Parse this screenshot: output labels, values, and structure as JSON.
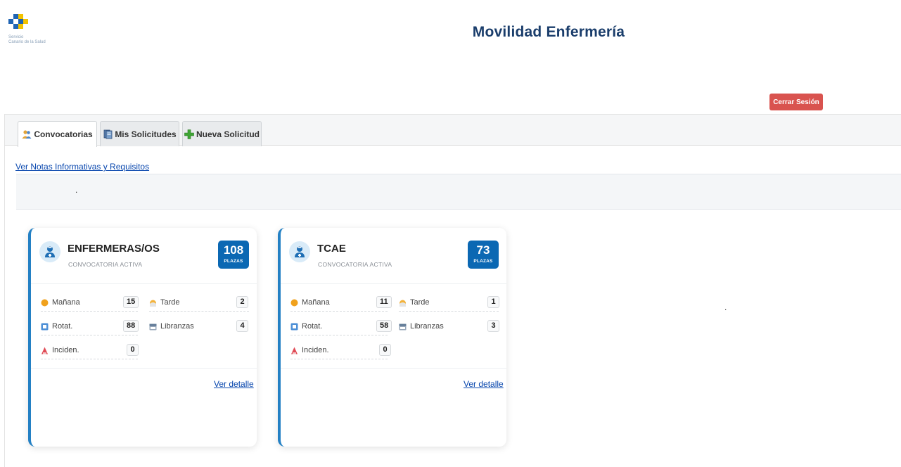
{
  "header": {
    "logo_lines": [
      "Servicio",
      "Canario de la Salud"
    ],
    "logo_small": [
      "",
      ""
    ],
    "title": "Movilidad Enfermería",
    "logout_label": "Cerrar Sesión",
    "logout_color": "#d9534f"
  },
  "tabs": [
    {
      "label": "Convocatorias",
      "icon": "people-icon",
      "active": true
    },
    {
      "label": "Mis Solicitudes",
      "icon": "documents-icon",
      "active": false
    },
    {
      "label": "Nueva Solicitud",
      "icon": "green-plus-icon",
      "active": false
    }
  ],
  "notes_link": "Ver Notas Informativas y Requisitos",
  "dots": [
    ".",
    "."
  ],
  "labels": {
    "manana": "Mañana",
    "tarde": "Tarde",
    "rotat": "Rotat.",
    "libranzas": "Libranzas",
    "inciden": "Inciden.",
    "plazas": "PLAZAS",
    "status": "CONVOCATORIA ACTIVA",
    "detail": "Ver detalle"
  },
  "cards": [
    {
      "title": "ENFERMERAS/OS",
      "plazas": "108",
      "manana": "15",
      "tarde": "2",
      "rotat": "88",
      "libranzas": "4",
      "inciden": "0"
    },
    {
      "title": "TCAE",
      "plazas": "73",
      "manana": "11",
      "tarde": "1",
      "rotat": "58",
      "libranzas": "3",
      "inciden": "0"
    }
  ],
  "colors": {
    "title": "#1a3d6b",
    "accent": "#2380c4",
    "plazas_badge": "#0b68b3",
    "link": "#0645ad"
  }
}
